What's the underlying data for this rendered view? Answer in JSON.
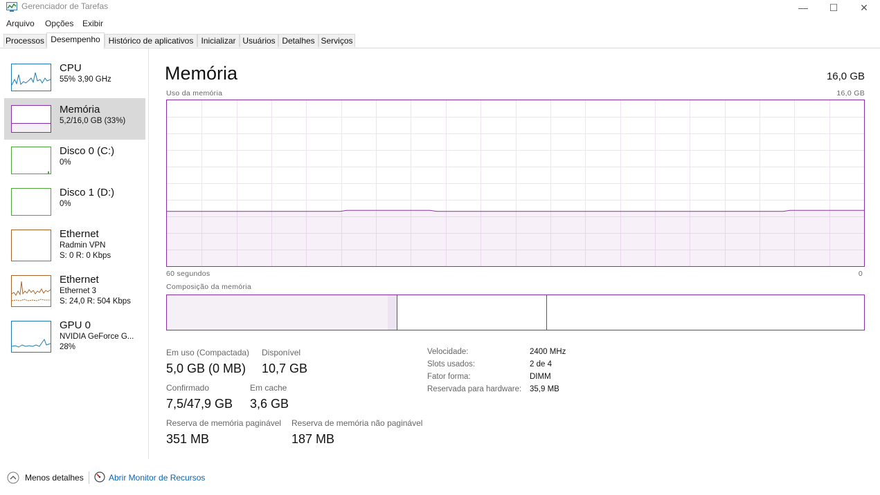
{
  "window": {
    "title": "Gerenciador de Tarefas",
    "minimize_glyph": "—",
    "maximize_glyph": "☐",
    "close_glyph": "✕"
  },
  "menu": [
    "Arquivo",
    "Opções",
    "Exibir"
  ],
  "tabs": [
    "Processos",
    "Desempenho",
    "Histórico de aplicativos",
    "Inicializar",
    "Usuários",
    "Detalhes",
    "Serviços"
  ],
  "active_tab": "Desempenho",
  "sidebar": {
    "items": [
      {
        "title": "CPU",
        "line1": "55%  3,90 GHz",
        "line2": "",
        "color": "#1f7ab3"
      },
      {
        "title": "Memória",
        "line1": "5,2/16,0 GB (33%)",
        "line2": "",
        "color": "#8b2fa8"
      },
      {
        "title": "Disco 0 (C:)",
        "line1": "0%",
        "line2": "",
        "color": "#4ca63a"
      },
      {
        "title": "Disco 1 (D:)",
        "line1": "0%",
        "line2": "",
        "color": "#4ca63a"
      },
      {
        "title": "Ethernet",
        "line1": "Radmin VPN",
        "line2": "S: 0  R: 0 Kbps",
        "color": "#a8652a"
      },
      {
        "title": "Ethernet",
        "line1": "Ethernet 3",
        "line2": "S: 24,0  R: 504 Kbps",
        "color": "#a8652a"
      },
      {
        "title": "GPU 0",
        "line1": "NVIDIA GeForce G...",
        "line2": "28%",
        "color": "#1f7ab3"
      }
    ]
  },
  "main": {
    "title": "Memória",
    "total": "16,0 GB",
    "usage_label": "Uso da memória",
    "usage_max": "16,0 GB",
    "time_label": "60 segundos",
    "time_min": "0",
    "usage_fraction": 0.33,
    "composition_label": "Composição da memória",
    "composition": {
      "in_use_fraction": 0.317,
      "modified_fraction": 0.013,
      "standby_fraction": 0.214
    },
    "stats": [
      {
        "label": "Em uso (Compactada)",
        "value": "5,0 GB (0 MB)"
      },
      {
        "label": "Disponível",
        "value": "10,7 GB"
      },
      {
        "label": "Confirmado",
        "value": "7,5/47,9 GB"
      },
      {
        "label": "Em cache",
        "value": "3,6 GB"
      },
      {
        "label": "Reserva de memória paginável",
        "value": "351 MB"
      },
      {
        "label": "Reserva de memória não paginável",
        "value": "187 MB"
      }
    ],
    "details": [
      {
        "label": "Velocidade:",
        "value": "2400 MHz"
      },
      {
        "label": "Slots usados:",
        "value": "2 de 4"
      },
      {
        "label": "Fator forma:",
        "value": "DIMM"
      },
      {
        "label": "Reservada para hardware:",
        "value": "35,9 MB"
      }
    ]
  },
  "footer": {
    "less_details": "Menos detalhes",
    "resource_monitor": "Abrir Monitor de Recursos"
  }
}
